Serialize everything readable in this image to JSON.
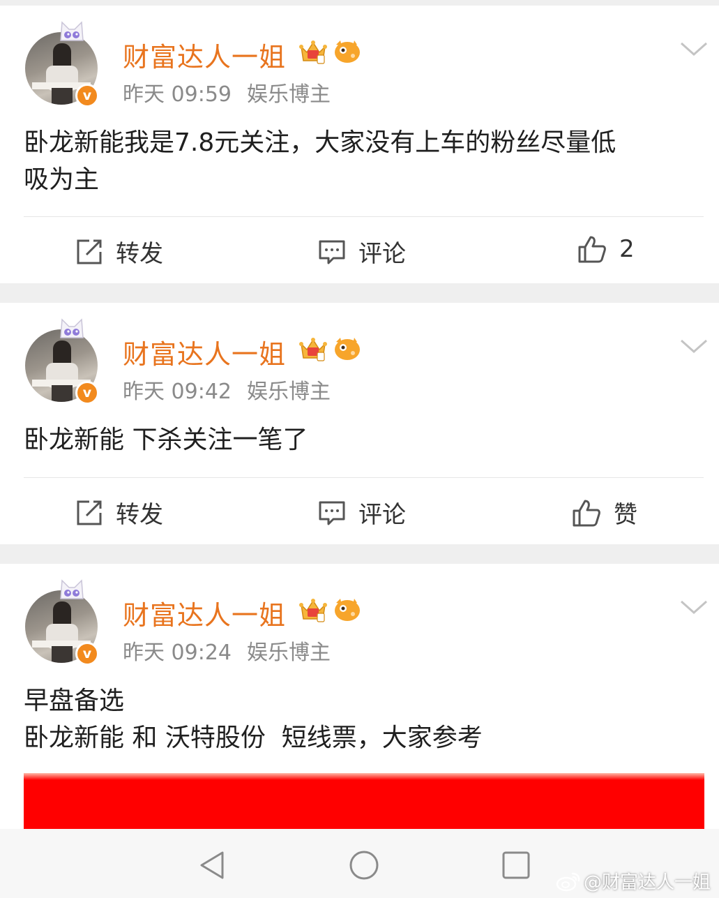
{
  "posts": [
    {
      "username": "财富达人一姐",
      "time": "昨天 09:59",
      "tag": "娱乐博主",
      "badge": "v",
      "content": "卧龙新能我是7.8元关注，大家没有上车的粉丝尽量低\n吸为主",
      "repost_label": "转发",
      "comment_label": "评论",
      "like_label": "2"
    },
    {
      "username": "财富达人一姐",
      "time": "昨天 09:42",
      "tag": "娱乐博主",
      "badge": "v",
      "content": "卧龙新能 下杀关注一笔了",
      "repost_label": "转发",
      "comment_label": "评论",
      "like_label": "赞"
    },
    {
      "username": "财富达人一姐",
      "time": "昨天 09:24",
      "tag": "娱乐博主",
      "badge": "v",
      "content": "早盘备选\n卧龙新能 和 沃特股份  短线票，大家参考"
    }
  ],
  "watermark": "@财富达人一姐",
  "colors": {
    "username": "#e8741e",
    "verified_badge": "#f28a1e",
    "banner": "#ff0000",
    "meta_text": "#8a8a8a"
  },
  "icons": [
    "cat-ears-icon",
    "crown-icon",
    "fish-icon",
    "chevron-down-icon",
    "repost-icon",
    "comment-icon",
    "thumbs-up-icon",
    "nav-back-icon",
    "nav-home-icon",
    "nav-recents-icon",
    "weibo-logo-icon"
  ]
}
